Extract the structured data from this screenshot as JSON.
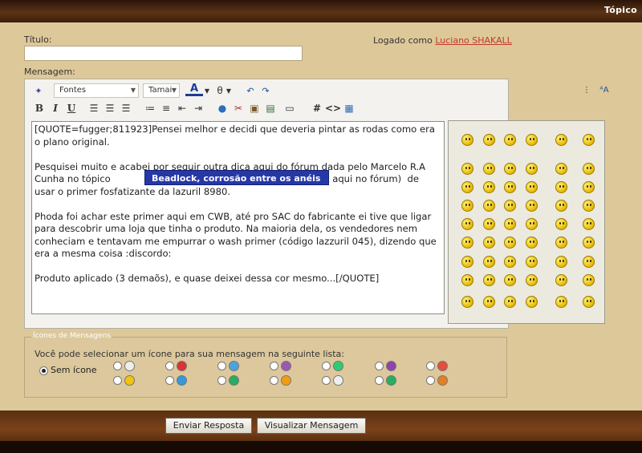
{
  "header": {
    "title": "Tópico"
  },
  "form": {
    "title_label": "Título:",
    "title_value": "",
    "logged_prefix": "Logado como",
    "logged_user": "Luciano SHAKALL",
    "message_label": "Mensagem:"
  },
  "toolbar": {
    "font_select": "Fontes",
    "size_select": "Tamai",
    "icons_row1": [
      "wand-icon",
      "font-dropdown",
      "size-dropdown",
      "text-color-icon",
      "highlight-icon",
      "undo-icon",
      "redo-icon"
    ],
    "icons_row2": [
      "bold-icon",
      "italic-icon",
      "underline-icon",
      "align-left-icon",
      "align-center-icon",
      "align-right-icon",
      "ordered-list-icon",
      "unordered-list-icon",
      "outdent-icon",
      "indent-icon",
      "link-icon",
      "unlink-icon",
      "image-icon",
      "photo-icon",
      "quote-icon",
      "hash-icon",
      "code-icon",
      "code-block-icon"
    ]
  },
  "editor": {
    "paragraphs": [
      "[QUOTE=fugger;811923]Pensei melhor e decidi que deveria pintar as rodas como era o plano original.",
      "Pesquisei muito e acabei por seguir outra dica aqui do fórum dada pelo Marcelo R.A Cunha no tópico                                   (não sei fazer o hiperlink aqui no fórum)  de usar o primer fosfatizante da lazuril 8980.",
      "Phoda foi achar este primer aqui em CWB, até pro SAC do fabricante ei tive que ligar para descobrir uma loja que tinha o produto. Na maioria dela, os vendedores nem conheciam e tentavam me empurrar o wash primer (código lazzuril 045), dizendo que era a mesma coisa :discordo:",
      "Produto aplicado (3 demaõs), e quase deixei dessa cor mesmo...[/QUOTE]"
    ],
    "tooltip": "Beadlock, corrosão entre os anéis"
  },
  "smilies": {
    "legend": ""
  },
  "icones": {
    "legend": "Ícones de Mensagens",
    "description": "Você pode selecionar um ícone para sua mensagem na seguinte lista:",
    "none_label": "Sem ícone",
    "selected": "none"
  },
  "buttons": {
    "submit": "Enviar Resposta",
    "preview": "Visualizar Mensagem"
  }
}
